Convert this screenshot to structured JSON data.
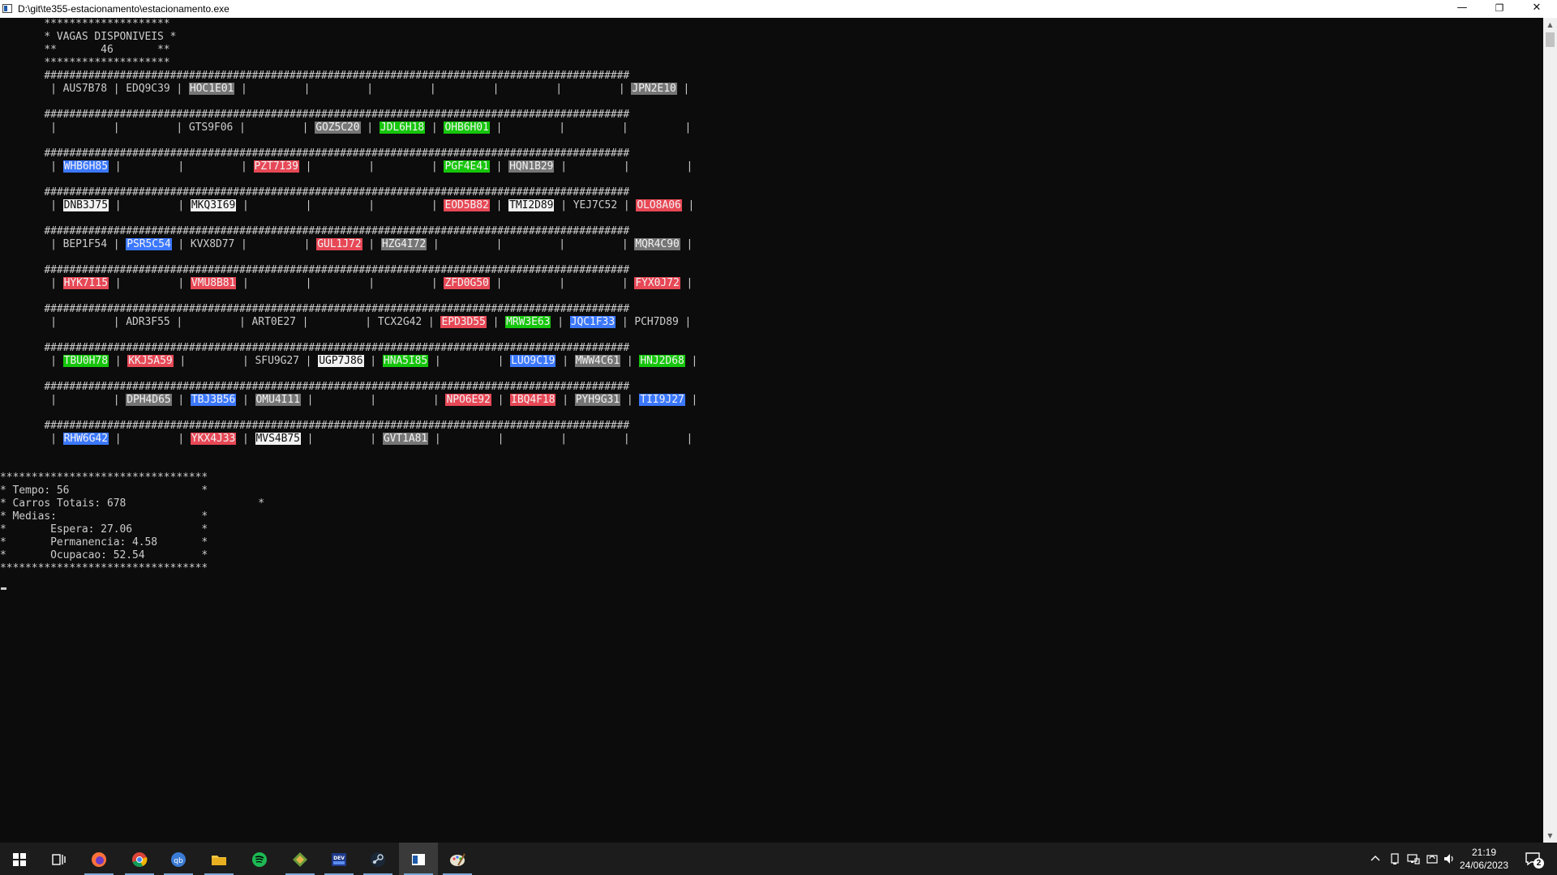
{
  "window": {
    "title": "D:\\git\\te355-estacionamento\\estacionamento.exe",
    "buttons": {
      "minimize": "—",
      "restore": "❐",
      "close": "✕"
    }
  },
  "colors": {
    "green": "#16c60c",
    "red": "#e74856",
    "blue": "#3b78ff",
    "gray": "#767676",
    "white": "#f2f2f2"
  },
  "console": {
    "header": [
      "       ********************",
      "       * VAGAS DISPONIVEIS *",
      "       **       46       **",
      "       ********************"
    ],
    "separator": "       #############################################################################################",
    "row_prefix": "        ",
    "rows": [
      [
        [
          "AUS7B78",
          ""
        ],
        [
          "EDQ9C39",
          ""
        ],
        [
          "HOC1E01",
          "gray"
        ],
        [
          "",
          ""
        ],
        [
          "",
          ""
        ],
        [
          "",
          ""
        ],
        [
          "",
          ""
        ],
        [
          "",
          ""
        ],
        [
          "",
          ""
        ],
        [
          "JPN2E10",
          "gray"
        ]
      ],
      [
        [
          "",
          ""
        ],
        [
          "",
          ""
        ],
        [
          "GTS9F06",
          ""
        ],
        [
          "",
          ""
        ],
        [
          "GOZ5C20",
          "gray"
        ],
        [
          "JDL6H18",
          "green"
        ],
        [
          "OHB6H01",
          "green"
        ],
        [
          "",
          ""
        ],
        [
          "",
          ""
        ],
        [
          "",
          ""
        ]
      ],
      [
        [
          "WHB6H85",
          "blue"
        ],
        [
          "",
          ""
        ],
        [
          "",
          ""
        ],
        [
          "PZT7I39",
          "red"
        ],
        [
          "",
          ""
        ],
        [
          "",
          ""
        ],
        [
          "PGF4E41",
          "green"
        ],
        [
          "HQN1B29",
          "gray"
        ],
        [
          "",
          ""
        ],
        [
          "",
          ""
        ]
      ],
      [
        [
          "DNB3J75",
          "white"
        ],
        [
          "",
          ""
        ],
        [
          "MKQ3I69",
          "white"
        ],
        [
          "",
          ""
        ],
        [
          "",
          ""
        ],
        [
          "",
          ""
        ],
        [
          "EOD5B82",
          "red"
        ],
        [
          "TMI2D89",
          "white"
        ],
        [
          "YEJ7C52",
          ""
        ],
        [
          "OLO8A06",
          "red"
        ]
      ],
      [
        [
          "BEP1F54",
          ""
        ],
        [
          "PSR5C54",
          "blue"
        ],
        [
          "KVX8D77",
          ""
        ],
        [
          "",
          ""
        ],
        [
          "GUL1J72",
          "red"
        ],
        [
          "HZG4I72",
          "gray"
        ],
        [
          "",
          ""
        ],
        [
          "",
          ""
        ],
        [
          "",
          ""
        ],
        [
          "MQR4C90",
          "gray"
        ]
      ],
      [
        [
          "HYK7I15",
          "red"
        ],
        [
          "",
          ""
        ],
        [
          "VMU8B81",
          "red"
        ],
        [
          "",
          ""
        ],
        [
          "",
          ""
        ],
        [
          "",
          ""
        ],
        [
          "ZFD0G50",
          "red"
        ],
        [
          "",
          ""
        ],
        [
          "",
          ""
        ],
        [
          "FYX0J72",
          "red"
        ]
      ],
      [
        [
          "",
          ""
        ],
        [
          "ADR3F55",
          ""
        ],
        [
          "",
          ""
        ],
        [
          "ART0E27",
          ""
        ],
        [
          "",
          ""
        ],
        [
          "TCX2G42",
          ""
        ],
        [
          "EPD3D55",
          "red"
        ],
        [
          "MRW3E63",
          "green"
        ],
        [
          "JQC1F33",
          "blue"
        ],
        [
          "PCH7D89",
          ""
        ]
      ],
      [
        [
          "TBU0H78",
          "green"
        ],
        [
          "KKJ5A59",
          "red"
        ],
        [
          "",
          ""
        ],
        [
          "SFU9G27",
          ""
        ],
        [
          "UGP7J86",
          "white"
        ],
        [
          "HNA5I85",
          "green"
        ],
        [
          "",
          ""
        ],
        [
          "LUO9C19",
          "blue"
        ],
        [
          "MWW4C61",
          "gray"
        ],
        [
          "HNJ2D68",
          "green"
        ]
      ],
      [
        [
          "",
          ""
        ],
        [
          "DPH4D65",
          "gray"
        ],
        [
          "TBJ3B56",
          "blue"
        ],
        [
          "OMU4I11",
          "gray"
        ],
        [
          "",
          ""
        ],
        [
          "",
          ""
        ],
        [
          "NPO6E92",
          "red"
        ],
        [
          "IBQ4F18",
          "red"
        ],
        [
          "PYH9G31",
          "gray"
        ],
        [
          "TII9J27",
          "blue"
        ]
      ],
      [
        [
          "RHW6G42",
          "blue"
        ],
        [
          "",
          ""
        ],
        [
          "YKX4J33",
          "red"
        ],
        [
          "MVS4B75",
          "white"
        ],
        [
          "",
          ""
        ],
        [
          "GVT1A81",
          "gray"
        ],
        [
          "",
          ""
        ],
        [
          "",
          ""
        ],
        [
          "",
          ""
        ],
        [
          "",
          ""
        ]
      ]
    ],
    "stats": [
      "*********************************",
      "* Tempo: 56                     *",
      "* Carros Totais: 678                     *",
      "* Medias:                       *",
      "*       Espera: 27.06           *",
      "*       Permanencia: 4.58       *",
      "*       Ocupacao: 52.54         *",
      "*********************************"
    ]
  },
  "taskbar": {
    "apps": [
      {
        "name": "start-icon"
      },
      {
        "name": "task-view-icon"
      },
      {
        "name": "firefox-icon",
        "running": true
      },
      {
        "name": "chrome-icon",
        "running": true
      },
      {
        "name": "qbittorrent-icon",
        "running": true
      },
      {
        "name": "file-explorer-icon",
        "running": true
      },
      {
        "name": "spotify-icon"
      },
      {
        "name": "gitkraken-icon",
        "running": true
      },
      {
        "name": "devcpp-icon",
        "running": true
      },
      {
        "name": "steam-icon",
        "running": true
      },
      {
        "name": "console-app-icon",
        "running": true,
        "active": true
      },
      {
        "name": "paint-icon",
        "running": true
      }
    ],
    "time": "21:19",
    "date": "24/06/2023",
    "notifications": "2"
  }
}
